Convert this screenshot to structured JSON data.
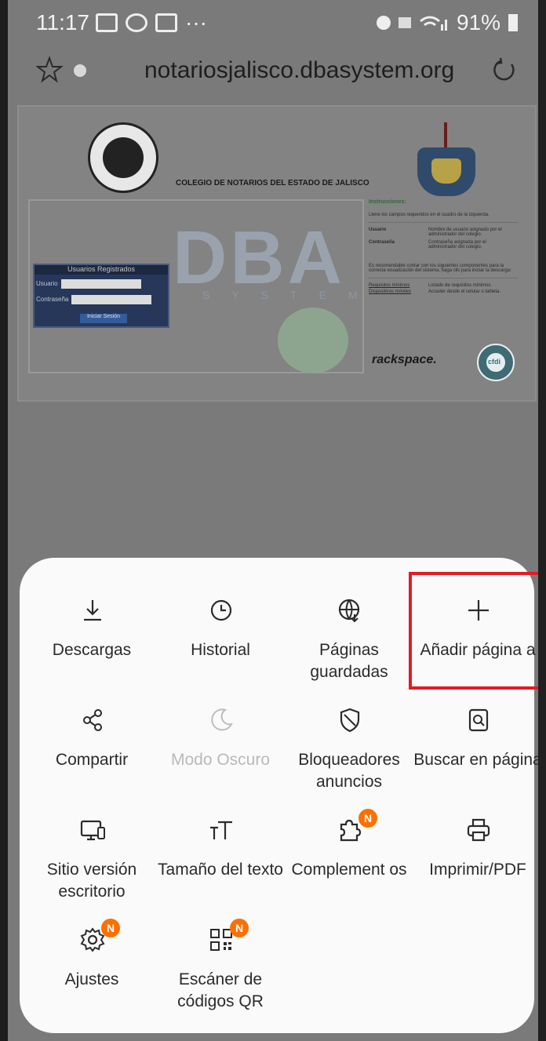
{
  "status_bar": {
    "time": "11:17",
    "dots": "···",
    "battery": "91%"
  },
  "browser": {
    "url": "notariosjalisco.dbasystem.org"
  },
  "webpage": {
    "heading": "COLEGIO DE NOTARIOS DEL ESTADO DE JALISCO",
    "dba_text": "DBA",
    "system_text": "SYSTEM",
    "login_title": "Usuarios Registrados",
    "login_user_label": "Usuario",
    "login_pass_label": "Contraseña",
    "login_button": "Iniciar Sesión",
    "instructions_title": "Instrucciones:",
    "instructions_line": "Llene los campos requeridos en el cuadro de la izquierda.",
    "usuario_label": "Usuario",
    "usuario_desc": "Nombre de usuario asignado por el administrador del colegio.",
    "contrasena_label": "Contraseña",
    "contrasena_desc": "Contraseña asignada por el administrador del colegio.",
    "recommend_text": "Es recomendable contar con los siguientes componentes para la correcta visualización del sistema, haga clic para iniciar la descarga:",
    "req_label": "Requisitos mínimos",
    "req_desc": "Listado de requisitos mínimos.",
    "devices_label": "Dispositivos móviles",
    "devices_desc": "Acceder desde el celular o tableta.",
    "rackspace": "rackspace.",
    "cfdi": "cfdi"
  },
  "menu": {
    "items": [
      {
        "label": "Descargas",
        "icon": "download-icon"
      },
      {
        "label": "Historial",
        "icon": "clock-icon"
      },
      {
        "label": "Páginas guardadas",
        "icon": "globe-saved-icon"
      },
      {
        "label": "Añadir página a",
        "icon": "plus-icon"
      },
      {
        "label": "Compartir",
        "icon": "share-icon"
      },
      {
        "label": "Modo Oscuro",
        "icon": "moon-icon"
      },
      {
        "label": "Bloqueadores anuncios",
        "icon": "shield-icon"
      },
      {
        "label": "Buscar en página",
        "icon": "search-page-icon"
      },
      {
        "label": "Sitio versión escritorio",
        "icon": "desktop-icon"
      },
      {
        "label": "Tamaño del texto",
        "icon": "text-size-icon"
      },
      {
        "label": "Complement os",
        "icon": "puzzle-icon",
        "badge": "N"
      },
      {
        "label": "Imprimir/PDF",
        "icon": "print-icon"
      },
      {
        "label": "Ajustes",
        "icon": "gear-icon",
        "badge": "N"
      },
      {
        "label": "Escáner de códigos QR",
        "icon": "qr-icon",
        "badge": "N"
      }
    ]
  },
  "colors": {
    "highlight": "#e31b23",
    "badge": "#ff6f00"
  }
}
